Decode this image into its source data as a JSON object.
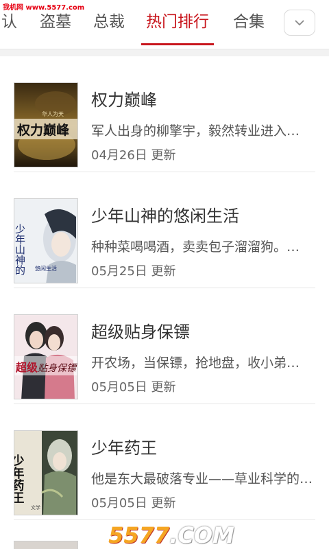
{
  "watermark_top": "我机网 www.5577.com",
  "tabs": [
    {
      "label": "认",
      "active": false
    },
    {
      "label": "盗墓",
      "active": false
    },
    {
      "label": "总裁",
      "active": false
    },
    {
      "label": "热门排行",
      "active": true
    },
    {
      "label": "合集",
      "active": false
    }
  ],
  "more_button_icon": "chevron-down-icon",
  "accent_color": "#c8161d",
  "books": [
    {
      "title": "权力巅峰",
      "desc": "军人出身的柳擎宇，毅然转业进入…",
      "date": "04月26日 更新",
      "cover_text": "权力巅峰",
      "cover_sub": "华人为天"
    },
    {
      "title": "少年山神的悠闲生活",
      "desc": "种种菜喝喝酒，卖卖包子溜溜狗。…",
      "date": "05月25日 更新",
      "cover_text": "少年山神的",
      "cover_sub": "悠闲生活"
    },
    {
      "title": "超级贴身保镖",
      "desc": "开农场，当保镖，抢地盘，收小弟…",
      "date": "05月05日 更新",
      "cover_text": "超级",
      "cover_sub": "贴身保镖"
    },
    {
      "title": "少年药王",
      "desc": "他是东大最破落专业——草业科学的…",
      "date": "05月05日 更新",
      "cover_text": "少年药王",
      "cover_sub": "文学"
    }
  ],
  "bottom_watermark": {
    "num": "5577",
    "com": ".COM"
  }
}
